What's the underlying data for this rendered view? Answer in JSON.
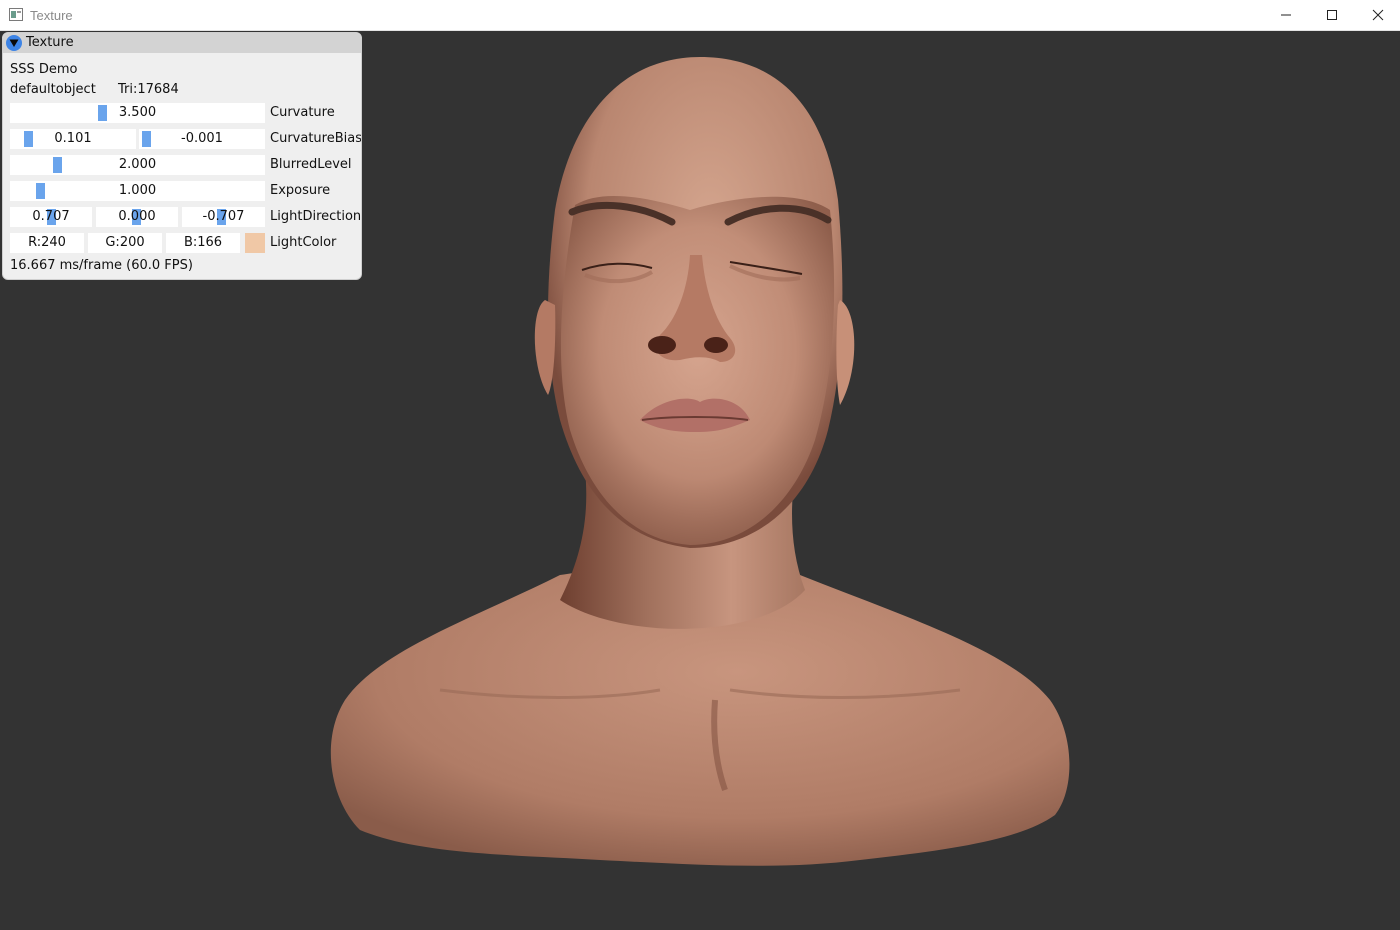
{
  "window": {
    "title": "Texture"
  },
  "panel": {
    "header": "Texture",
    "lines": {
      "demo": "SSS Demo",
      "object": "defaultobject",
      "tris": "Tri:17684"
    },
    "curvature": {
      "label": "Curvature",
      "value": "3.500",
      "fraction": 0.35
    },
    "curvature_bias": {
      "label": "CurvatureBias",
      "values": [
        "0.101",
        "-0.001"
      ]
    },
    "blurred_level": {
      "label": "BlurredLevel",
      "value": "2.000"
    },
    "exposure": {
      "label": "Exposure",
      "value": "1.000"
    },
    "light_direction": {
      "label": "LightDirection",
      "values": [
        "0.707",
        "0.000",
        "-0.707"
      ]
    },
    "light_color": {
      "label": "LightColor",
      "r": "R:240",
      "g": "G:200",
      "b": "B:166",
      "hex": "#f0c8a6"
    },
    "fps": "16.667 ms/frame (60.0 FPS)"
  },
  "colors": {
    "background": "#333333",
    "accent": "#6aa4ec",
    "skin": "#c8927a"
  },
  "icons": [
    "app-icon",
    "minimize-icon",
    "maximize-icon",
    "close-icon",
    "collapse-arrow-icon"
  ]
}
